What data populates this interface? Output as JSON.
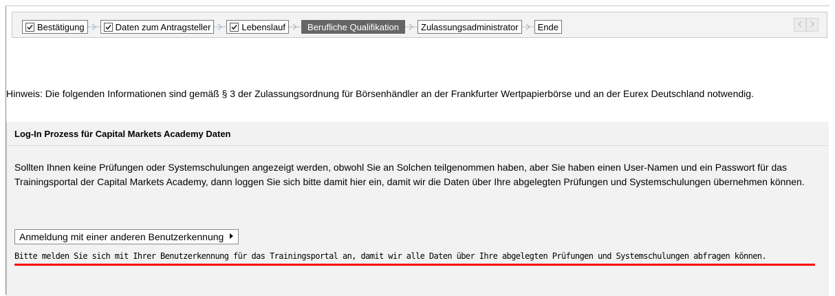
{
  "roadmap": {
    "steps": [
      {
        "label": "Bestätigung",
        "checked": true
      },
      {
        "label": "Daten zum Antragsteller",
        "checked": true
      },
      {
        "label": "Lebenslauf",
        "checked": true
      },
      {
        "label": "Berufliche Qualifikation",
        "active": true
      },
      {
        "label": "Zulassungsadministrator"
      },
      {
        "label": "Ende"
      }
    ],
    "nav_icons": [
      "chevron-left-icon",
      "chevron-right-icon"
    ]
  },
  "hint": "Hinweis: Die folgenden Informationen sind gemäß § 3 der Zulassungsordnung für Börsenhändler an der Frankfurter Wertpapierbörse und an der Eurex Deutschland notwendig.",
  "panel": {
    "title": "Log-In Prozess für Capital Markets Academy Daten",
    "body": "Sollten Ihnen keine Prüfungen oder Systemschulungen angezeigt werden, obwohl Sie an Solchen teilgenommen haben, aber Sie haben einen User-Namen und ein Passwort für das Trainingsportal der Capital Markets Academy, dann loggen Sie sich bitte damit hier ein, damit wir die Daten über Ihre abgelegten Prüfungen und Systemschulungen übernehmen können.",
    "login_button": "Anmeldung mit einer anderen Benutzerkennung",
    "note": "Bitte melden Sie sich mit Ihrer Benutzerkennung für das Trainingsportal an, damit wir alle Daten über Ihre abgelegten Prüfungen und Systemschulungen abfragen können."
  },
  "colors": {
    "active_step": "#666666",
    "annotation_underline": "#ff0000"
  }
}
